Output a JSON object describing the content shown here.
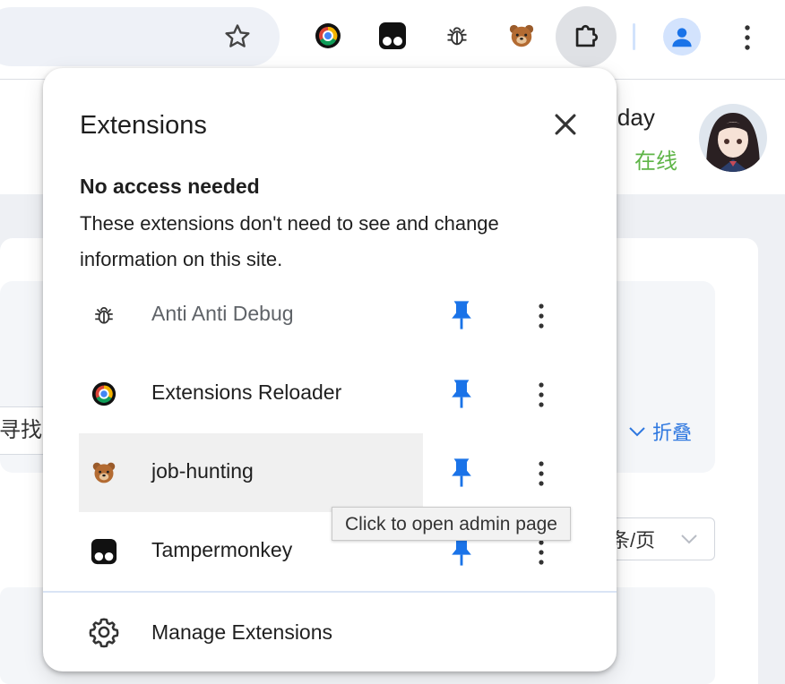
{
  "browser": {
    "toolbar_icons": [
      "extensions-reloader-icon",
      "tampermonkey-icon",
      "bug-icon",
      "bear-icon"
    ],
    "extensions_button_icon": "puzzle-icon",
    "profile_icon": "person-icon"
  },
  "page": {
    "username_fragment": "unday",
    "status": "在线",
    "search_fragment": "寻找仁",
    "fold_label": "折叠",
    "pager_label": "条/页"
  },
  "popup": {
    "title": "Extensions",
    "section_title": "No access needed",
    "section_desc": "These extensions don't need to see and change information on this site.",
    "extensions": [
      {
        "name": "Anti Anti Debug",
        "icon": "bug-icon",
        "pinned": true
      },
      {
        "name": "Extensions Reloader",
        "icon": "reload-icon",
        "pinned": true
      },
      {
        "name": "job-hunting",
        "icon": "bear-icon",
        "pinned": true
      },
      {
        "name": "Tampermonkey",
        "icon": "tampermonkey-icon",
        "pinned": true
      }
    ],
    "manage_label": "Manage Extensions"
  },
  "tooltip": "Click to open admin page",
  "colors": {
    "pin": "#1a73e8",
    "online": "#5fb548",
    "link": "#2f78e0"
  }
}
